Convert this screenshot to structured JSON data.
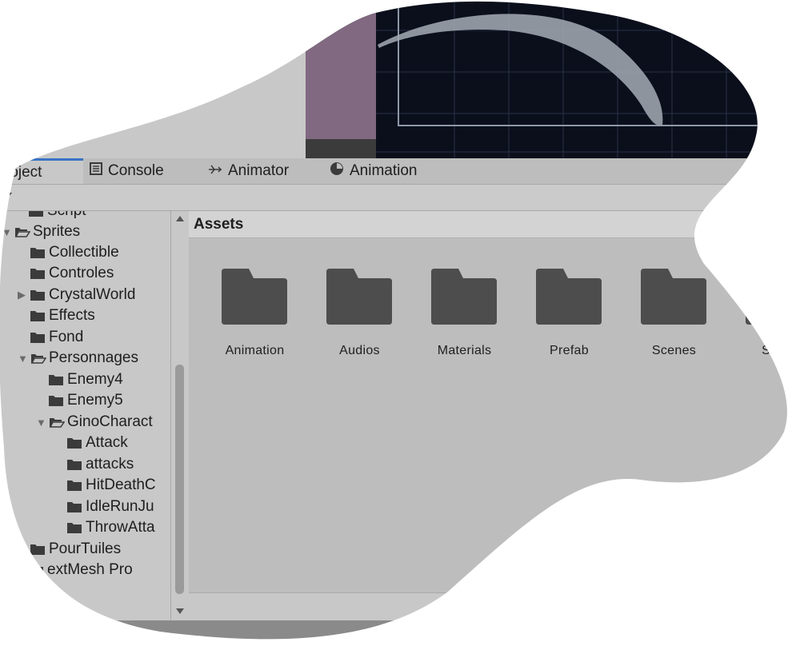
{
  "tabs": [
    {
      "label": "roject",
      "icon": "folder-icon",
      "active": true
    },
    {
      "label": "Console",
      "icon": "console-icon",
      "active": false
    },
    {
      "label": "Animator",
      "icon": "animator-icon",
      "active": false
    },
    {
      "label": "Animation",
      "icon": "clock-icon",
      "active": false
    }
  ],
  "tree": [
    {
      "label": "Script",
      "depth": 0,
      "expanded": null,
      "open": false
    },
    {
      "label": "Sprites",
      "depth": 0,
      "expanded": true,
      "open": true
    },
    {
      "label": "Collectible",
      "depth": 1,
      "expanded": null,
      "open": false
    },
    {
      "label": "Controles",
      "depth": 1,
      "expanded": null,
      "open": false
    },
    {
      "label": "CrystalWorld",
      "depth": 1,
      "expanded": false,
      "open": false
    },
    {
      "label": "Effects",
      "depth": 1,
      "expanded": null,
      "open": false
    },
    {
      "label": "Fond",
      "depth": 1,
      "expanded": null,
      "open": false
    },
    {
      "label": "Personnages",
      "depth": 1,
      "expanded": true,
      "open": true
    },
    {
      "label": "Enemy4",
      "depth": 2,
      "expanded": null,
      "open": false
    },
    {
      "label": "Enemy5",
      "depth": 2,
      "expanded": null,
      "open": false
    },
    {
      "label": "GinoCharact",
      "depth": 2,
      "expanded": true,
      "open": true
    },
    {
      "label": "Attack",
      "depth": 3,
      "expanded": null,
      "open": false
    },
    {
      "label": "attacks",
      "depth": 3,
      "expanded": null,
      "open": false
    },
    {
      "label": "HitDeathC",
      "depth": 3,
      "expanded": null,
      "open": false
    },
    {
      "label": "IdleRunJu",
      "depth": 3,
      "expanded": null,
      "open": false
    },
    {
      "label": "ThrowAtta",
      "depth": 3,
      "expanded": null,
      "open": false
    },
    {
      "label": "PourTuiles",
      "depth": 1,
      "expanded": null,
      "open": false
    },
    {
      "label": "extMesh Pro",
      "depth": 0,
      "expanded": null,
      "open": false
    }
  ],
  "assets": {
    "title": "Assets",
    "items": [
      "Animation",
      "Audios",
      "Materials",
      "Prefab",
      "Scenes",
      "Script"
    ]
  },
  "colors": {
    "scene_bg": "#0b0f1c",
    "accent": "#3a72c4",
    "folder": "#4d4d4d"
  }
}
